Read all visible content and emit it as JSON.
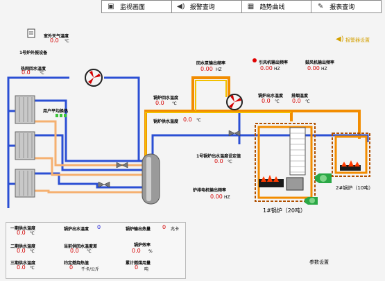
{
  "nav": {
    "items": [
      {
        "label": "监视画面",
        "icon": "monitor-icon"
      },
      {
        "label": "报警查询",
        "icon": "alarm-icon"
      },
      {
        "label": "趋势曲线",
        "icon": "trend-icon"
      },
      {
        "label": "报表查询",
        "icon": "report-icon"
      }
    ]
  },
  "alarm_link": "报警器设置",
  "outdoor": {
    "label": "室外天气温度",
    "value": "0.0",
    "unit": "℃"
  },
  "station_label": "1号炉外报设备",
  "heat_return": {
    "label": "热网回水温度",
    "value": "0.0",
    "unit": "℃"
  },
  "user_avg": {
    "label": "用户平均换热"
  },
  "return_pump": {
    "label": "回水泵输出频率",
    "value": "0.00",
    "unit": "HZ"
  },
  "induced_fan": {
    "label": "引风机输出频率",
    "value": "0.00",
    "unit": "HZ"
  },
  "blower_fan": {
    "label": "鼓风机输出频率",
    "value": "0.00",
    "unit": "HZ"
  },
  "boiler_return": {
    "label": "锅炉回水温度",
    "value": "0.0",
    "unit": "℃"
  },
  "boiler_supply": {
    "label": "锅炉供水温度",
    "value": "0.0",
    "unit": "℃"
  },
  "boiler_out": {
    "label": "锅炉出水温度",
    "value": "0.0",
    "unit": "℃"
  },
  "flue_temp": {
    "label": "排烟温度",
    "value": "0.0",
    "unit": "℃"
  },
  "setpoint": {
    "label": "1号锅炉出水温度设定值",
    "value": "0.0",
    "unit": "℃"
  },
  "grate": {
    "label": "炉排电机输出频率",
    "value": "0.00",
    "unit": "HZ"
  },
  "boiler1": {
    "label": "1#锅炉（20吨）"
  },
  "boiler2": {
    "label": "2#锅炉（10吨）"
  },
  "panel": {
    "p1_supply": {
      "label": "一期供水温度",
      "value": "0.0",
      "unit": "℃"
    },
    "p2_supply": {
      "label": "二期供水温度",
      "value": "0.0",
      "unit": "℃"
    },
    "p3_supply": {
      "label": "三期供水温度",
      "value": "0.0",
      "unit": "℃"
    },
    "out_temp": {
      "label": "锅炉出水温度",
      "value": "0"
    },
    "cur_return": {
      "label": "当前供回水温度差",
      "value": "0.0",
      "unit": "℃"
    },
    "fuel_heat": {
      "label": "约定燃烧热值",
      "value": "0",
      "unit": "千卡/公斤"
    },
    "heat_out": {
      "label": "锅炉输出热量",
      "value": "0",
      "unit": "兆卡"
    },
    "efficiency": {
      "label": "锅炉效率",
      "value": "0.0",
      "unit": "%"
    },
    "fuel_total": {
      "label": "累计燃煤用量",
      "value": "0",
      "unit": "吨"
    }
  },
  "params_btn": "参数设置"
}
